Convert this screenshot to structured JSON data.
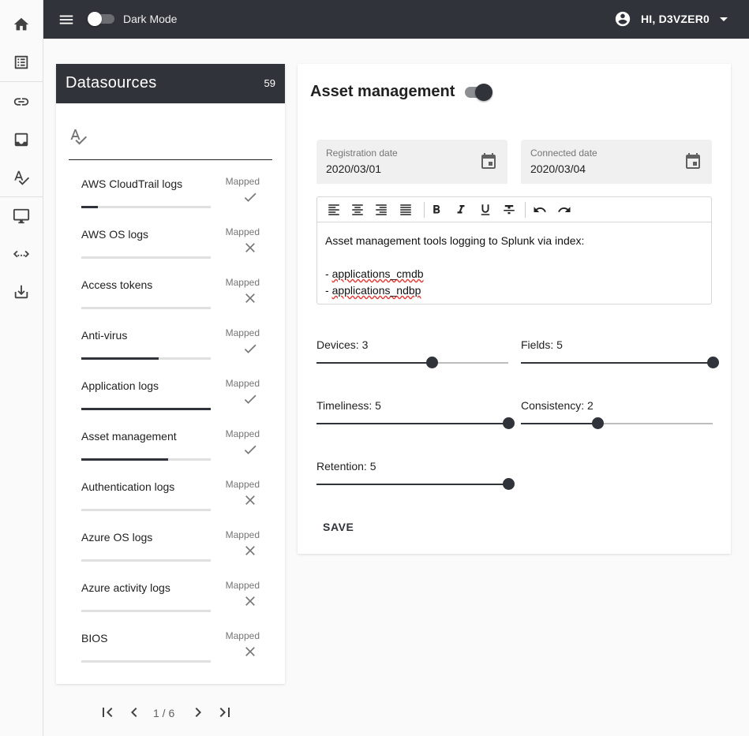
{
  "topbar": {
    "dark_mode_label": "Dark Mode",
    "dark_mode_on": false,
    "user_greeting": "HI, D3VZER0"
  },
  "nav_rail": {
    "items": [
      {
        "icon": "home-icon"
      },
      {
        "icon": "list-icon"
      },
      {
        "icon": "link-icon"
      },
      {
        "icon": "inbox-icon"
      },
      {
        "icon": "spellcheck-icon"
      },
      {
        "icon": "monitor-icon"
      },
      {
        "icon": "code-icon"
      },
      {
        "icon": "download-icon"
      }
    ]
  },
  "datasources": {
    "title": "Datasources",
    "count": "59",
    "search_value": "",
    "items": [
      {
        "name": "AWS CloudTrail logs",
        "mapped_label": "Mapped",
        "mapped": true,
        "progress": 0.13
      },
      {
        "name": "AWS OS logs",
        "mapped_label": "Mapped",
        "mapped": false,
        "progress": 0
      },
      {
        "name": "Access tokens",
        "mapped_label": "Mapped",
        "mapped": false,
        "progress": 0
      },
      {
        "name": "Anti-virus",
        "mapped_label": "Mapped",
        "mapped": true,
        "progress": 0.6
      },
      {
        "name": "Application logs",
        "mapped_label": "Mapped",
        "mapped": true,
        "progress": 1.0
      },
      {
        "name": "Asset management",
        "mapped_label": "Mapped",
        "mapped": true,
        "progress": 0.67
      },
      {
        "name": "Authentication logs",
        "mapped_label": "Mapped",
        "mapped": false,
        "progress": 0
      },
      {
        "name": "Azure OS logs",
        "mapped_label": "Mapped",
        "mapped": false,
        "progress": 0
      },
      {
        "name": "Azure activity logs",
        "mapped_label": "Mapped",
        "mapped": false,
        "progress": 0
      },
      {
        "name": "BIOS",
        "mapped_label": "Mapped",
        "mapped": false,
        "progress": 0
      }
    ],
    "pagination": {
      "text": "1 / 6"
    }
  },
  "detail": {
    "title": "Asset management",
    "enabled": true,
    "registration": {
      "label": "Registration date",
      "value": "2020/03/01"
    },
    "connected": {
      "label": "Connected date",
      "value": "2020/03/04"
    },
    "editor": {
      "line1": "Asset management tools logging to Splunk via index:",
      "line2_prefix": "- ",
      "line2_index": "applications_cmdb",
      "line3_prefix": "- ",
      "line3_index": "applications_ndbp"
    },
    "sliders": [
      {
        "label": "Devices: 3",
        "value": 3,
        "max": 5
      },
      {
        "label": "Fields: 5",
        "value": 5,
        "max": 5
      },
      {
        "label": "Timeliness: 5",
        "value": 5,
        "max": 5
      },
      {
        "label": "Consistency: 2",
        "value": 2,
        "max": 5
      },
      {
        "label": "Retention: 5",
        "value": 5,
        "max": 5
      }
    ],
    "save_label": "SAVE"
  },
  "colors": {
    "appbar": "#303339",
    "accent": "#303339",
    "track": "#bdbdbd"
  }
}
